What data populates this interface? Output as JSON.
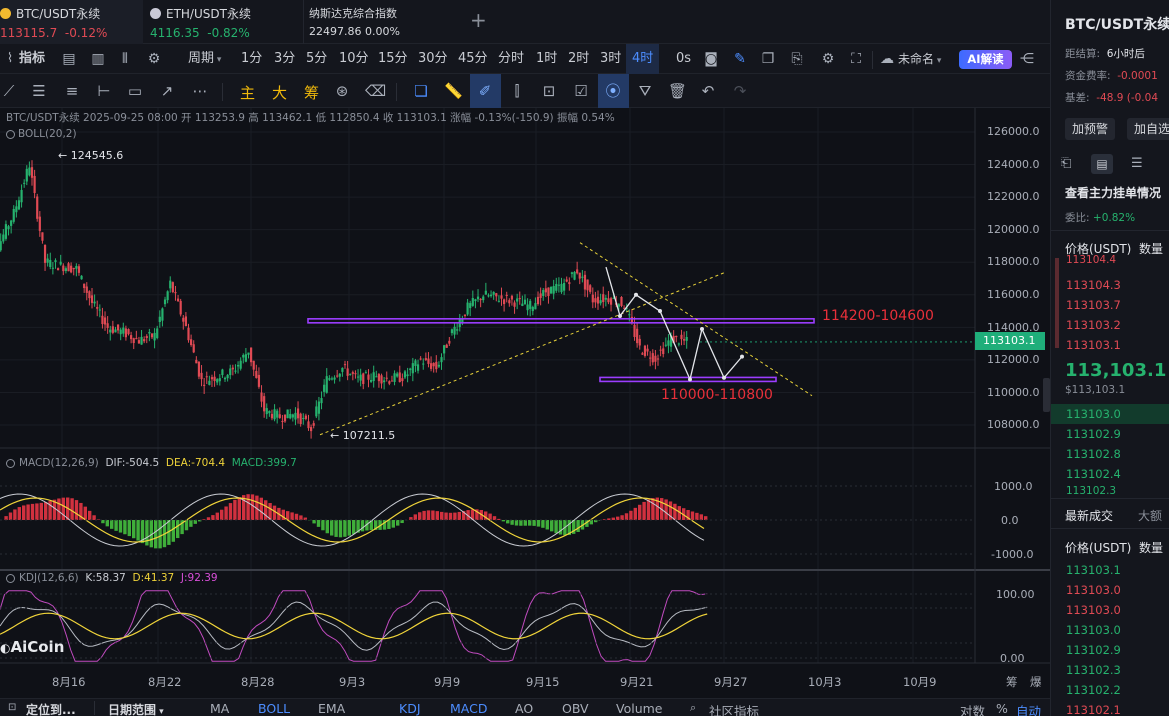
{
  "tabs": [
    {
      "symbol": "BTC/USDT永续",
      "price": "113115.7",
      "change": "-0.12%",
      "active": true
    },
    {
      "symbol": "ETH/USDT永续",
      "price": "4116.35",
      "change": "-0.82%",
      "active": false
    },
    {
      "symbol": "纳斯达克综合指数",
      "price": "22497.86",
      "change": "0.00%",
      "active": false
    }
  ],
  "add_tab": "+",
  "toolbar": {
    "indicator_label": "指标",
    "period_label": "周期",
    "intervals": [
      "1分",
      "3分",
      "5分",
      "10分",
      "15分",
      "30分",
      "45分",
      "分时",
      "1时",
      "2时",
      "3时",
      "4时"
    ],
    "active_interval": "4时",
    "countdown": "0s",
    "layout_name": "未命名",
    "ai_label": "AI解读"
  },
  "drawing_tools": {
    "main": "主",
    "big": "大",
    "chips": "筹"
  },
  "legend": {
    "ohlc": "BTC/USDT永续  2025-09-25 08:00  开 113253.9  高 113462.1  低 112850.4  收 113103.1  涨幅 -0.13%(-150.9)  振幅 0.54%",
    "boll": "BOLL(20,2)",
    "macd_name": "MACD(12,26,9)",
    "macd_dif": "DIF:-504.5",
    "macd_dea": "DEA:-704.4",
    "macd_val": "MACD:399.7",
    "kdj_name": "KDJ(12,6,6)",
    "kdj_k": "K:58.37",
    "kdj_d": "D:41.37",
    "kdj_j": "J:92.39"
  },
  "y_axis": [
    "126000.0",
    "124000.0",
    "122000.0",
    "120000.0",
    "118000.0",
    "116000.0",
    "114000.0",
    "112000.0",
    "110000.0",
    "108000.0"
  ],
  "current_price_tag": "113103.1",
  "macd_axis": [
    "1000.0",
    "0.0",
    "-1000.0"
  ],
  "kdj_axis": [
    "100.00",
    "0.00"
  ],
  "x_axis": [
    "8月16",
    "8月22",
    "8月28",
    "9月3",
    "9月9",
    "9月15",
    "9月21",
    "9月27",
    "10月3",
    "10月9"
  ],
  "annotations": {
    "high": "124545.6",
    "low": "107211.5",
    "upper_zone": "114200-104600",
    "lower_zone": "110000-110800"
  },
  "watermark": "AiCoin",
  "bottom_bar": {
    "locate": "定位到...",
    "range": "日期范围",
    "indicators": [
      "MA",
      "BOLL",
      "EMA",
      "KDJ",
      "MACD",
      "AO",
      "OBV",
      "Volume"
    ],
    "active_indicators": [
      "BOLL",
      "KDJ",
      "MACD"
    ],
    "community": "社区指标",
    "log": "对数",
    "percent": "%",
    "auto": "自动"
  },
  "corner_labels": {
    "a": "筹",
    "b": "爆"
  },
  "right_panel": {
    "title": "BTC/USDT永续",
    "settle_label": "距结算:",
    "settle_value": "6小时后",
    "funding_label": "资金费率:",
    "funding_value": "-0.0001",
    "basis_label": "基差:",
    "basis_value": "-48.9 (-0.04",
    "alert_btn": "加预警",
    "watch_btn": "加自选",
    "depth_title": "查看主力挂单情况",
    "ratio_label": "委比:",
    "ratio_value": "+0.82%",
    "ob_header_price": "价格(USDT)",
    "ob_header_qty": "数量",
    "asks": [
      "113104.4",
      "113104.3",
      "113103.7",
      "113103.2",
      "113103.1"
    ],
    "last_price": "113,103.1",
    "last_price_sub": "$113,103.1",
    "bids": [
      "113103.0",
      "113102.9",
      "113102.8",
      "113102.4",
      "113102.3"
    ],
    "trades_tab": "最新成交",
    "big_tab": "大额",
    "trades": [
      {
        "p": "113103.1",
        "c": "green"
      },
      {
        "p": "113103.0",
        "c": "red"
      },
      {
        "p": "113103.0",
        "c": "red"
      },
      {
        "p": "113103.0",
        "c": "green"
      },
      {
        "p": "113102.9",
        "c": "green"
      },
      {
        "p": "113102.3",
        "c": "green"
      },
      {
        "p": "113102.2",
        "c": "green"
      },
      {
        "p": "113102.1",
        "c": "red"
      }
    ]
  },
  "chart_data": {
    "type": "candlestick",
    "symbol": "BTC/USDT永续",
    "interval": "4时",
    "x_ticks": [
      "8月16",
      "8月22",
      "8月28",
      "9月3",
      "9月9",
      "9月15",
      "9月21",
      "9月27",
      "10月3",
      "10月9"
    ],
    "y_range": [
      106800,
      127000
    ],
    "key_points": [
      {
        "date": "8月14",
        "value": 124545.6,
        "label": "124545.6"
      },
      {
        "date": "9月1",
        "value": 107211.5,
        "label": "107211.5"
      }
    ],
    "close_path": [
      [
        "8月11",
        120800
      ],
      [
        "8月12",
        119000
      ],
      [
        "8月13",
        121000
      ],
      [
        "8月14",
        124000
      ],
      [
        "8月15",
        118000
      ],
      [
        "8月16",
        117800
      ],
      [
        "8月17",
        117600
      ],
      [
        "8月18",
        115500
      ],
      [
        "8月19",
        114000
      ],
      [
        "8月20",
        113700
      ],
      [
        "8月21",
        113200
      ],
      [
        "8月22",
        113500
      ],
      [
        "8月23",
        116700
      ],
      [
        "8月24",
        114000
      ],
      [
        "8月25",
        110700
      ],
      [
        "8月26",
        111000
      ],
      [
        "8月27",
        111300
      ],
      [
        "8月28",
        112600
      ],
      [
        "8月29",
        108900
      ],
      [
        "8月30",
        108500
      ],
      [
        "8月31",
        108700
      ],
      [
        "9月1",
        107800
      ],
      [
        "9月2",
        110800
      ],
      [
        "9月3",
        111500
      ],
      [
        "9月4",
        110800
      ],
      [
        "9月5",
        111000
      ],
      [
        "9月6",
        110800
      ],
      [
        "9月7",
        111000
      ],
      [
        "9月8",
        112000
      ],
      [
        "9月9",
        111500
      ],
      [
        "9月10",
        113700
      ],
      [
        "9月11",
        115200
      ],
      [
        "9月12",
        116000
      ],
      [
        "9月13",
        115800
      ],
      [
        "9月14",
        115600
      ],
      [
        "9月15",
        115300
      ],
      [
        "9月16",
        116200
      ],
      [
        "9月17",
        116500
      ],
      [
        "9月18",
        117500
      ],
      [
        "9月19",
        115700
      ],
      [
        "9月20",
        115800
      ],
      [
        "9月21",
        115400
      ],
      [
        "9月22",
        112700
      ],
      [
        "9月23",
        112100
      ],
      [
        "9月24",
        113300
      ],
      [
        "9月25",
        113103.1
      ]
    ],
    "current_price": 113103.1,
    "horizontal_zones": [
      {
        "label": "114200-104600",
        "price": 114400
      },
      {
        "label": "110000-110800",
        "price": 110800
      }
    ],
    "indicators": {
      "MACD": {
        "params": "12,26,9",
        "DIF": -504.5,
        "DEA": -704.4,
        "MACD": 399.7,
        "axis": [
          1000,
          0,
          -1000
        ]
      },
      "KDJ": {
        "params": "12,6,6",
        "K": 58.37,
        "D": 41.37,
        "J": 92.39,
        "axis": [
          100,
          0
        ]
      }
    }
  }
}
